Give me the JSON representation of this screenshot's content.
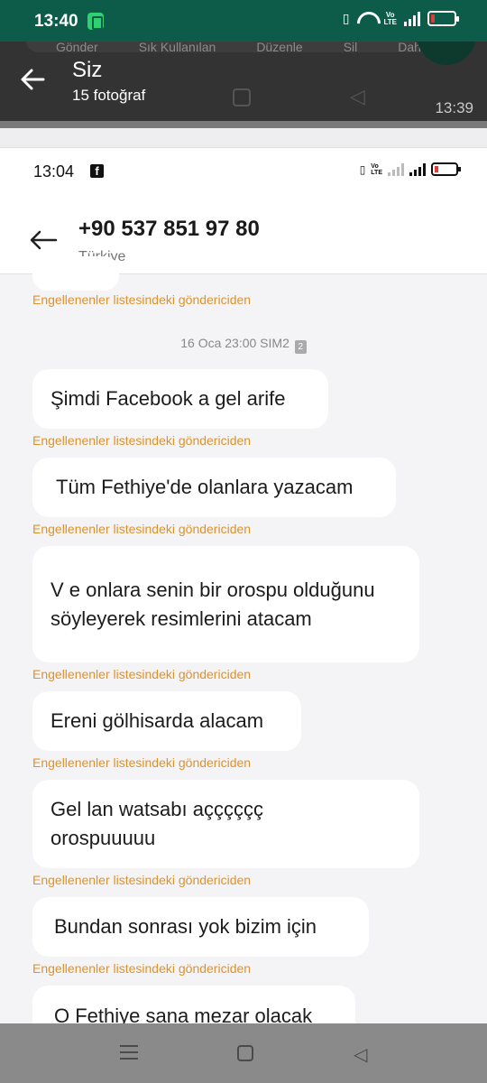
{
  "outer_status": {
    "time": "13:40"
  },
  "viewer": {
    "title": "Siz",
    "subtitle": "15 fotoğraf",
    "timestamp": "13:39",
    "ghost_menu": [
      "Gönder",
      "Sık Kullanılan",
      "Düzenle",
      "Sil",
      "Daha fazla"
    ]
  },
  "inner_status": {
    "time": "13:04"
  },
  "contact": {
    "number": "+90 537 851 97 80",
    "country": "Türkiye"
  },
  "blocked_label": "Engellenenler listesindeki göndericiden",
  "date_stamp": "16 Oca 23:00  SIM2",
  "messages": [
    {
      "text": "Şimdi Facebook a gel arife"
    },
    {
      "text": "Tüm Fethiye'de olanlara yazacam"
    },
    {
      "text": "V e onlara senin bir orospu olduğunu söyleyerek resimlerini atacam"
    },
    {
      "text": "Ereni gölhisarda alacam"
    },
    {
      "text": "Gel lan watsabı açççççç orospuuuuu"
    },
    {
      "text": "Bundan sonrası yok bizim için"
    },
    {
      "text": "O Fethiye sana mezar olacak"
    }
  ]
}
